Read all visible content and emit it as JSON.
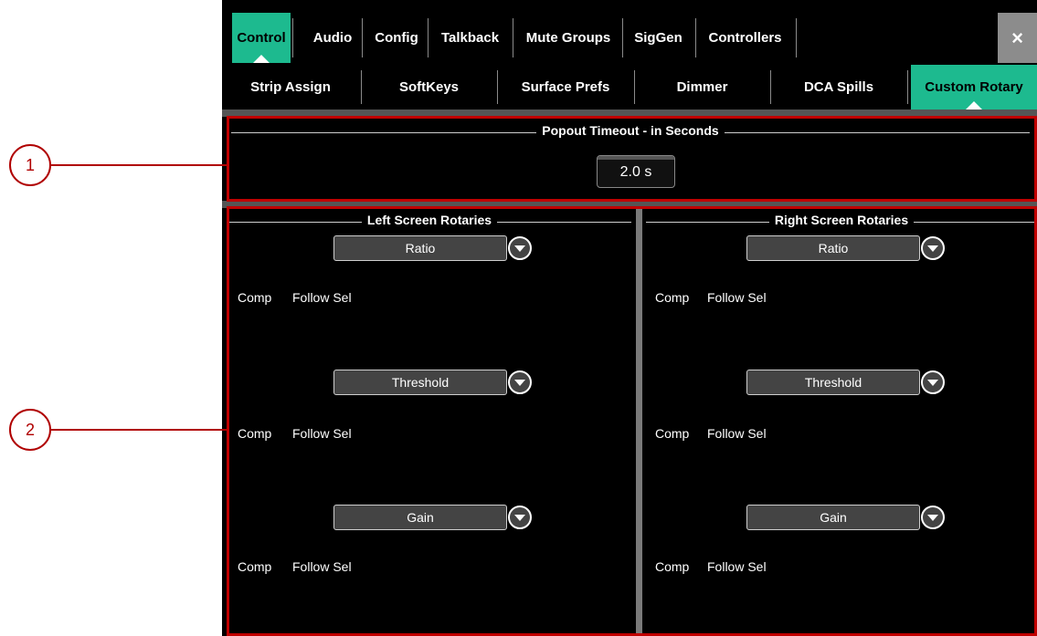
{
  "top_tabs": [
    "Control",
    "Audio",
    "Config",
    "Talkback",
    "Mute Groups",
    "SigGen",
    "Controllers"
  ],
  "top_active": "Control",
  "close_symbol": "×",
  "sub_tabs": [
    "Strip Assign",
    "SoftKeys",
    "Surface Prefs",
    "Dimmer",
    "DCA Spills",
    "Custom Rotary"
  ],
  "sub_active": "Custom Rotary",
  "popout": {
    "title": "Popout Timeout - in Seconds",
    "value": "2.0 s"
  },
  "left": {
    "title": "Left Screen Rotaries",
    "rotaries": [
      {
        "select": "Ratio",
        "caption_a": "Comp",
        "caption_b": "Follow Sel"
      },
      {
        "select": "Threshold",
        "caption_a": "Comp",
        "caption_b": "Follow Sel"
      },
      {
        "select": "Gain",
        "caption_a": "Comp",
        "caption_b": "Follow Sel"
      }
    ]
  },
  "right": {
    "title": "Right Screen Rotaries",
    "rotaries": [
      {
        "select": "Ratio",
        "caption_a": "Comp",
        "caption_b": "Follow Sel"
      },
      {
        "select": "Threshold",
        "caption_a": "Comp",
        "caption_b": "Follow Sel"
      },
      {
        "select": "Gain",
        "caption_a": "Comp",
        "caption_b": "Follow Sel"
      }
    ]
  },
  "callouts": [
    "1",
    "2"
  ],
  "colors": {
    "accent": "#1dba8f",
    "annotation": "#c00000",
    "background": "#000000"
  }
}
